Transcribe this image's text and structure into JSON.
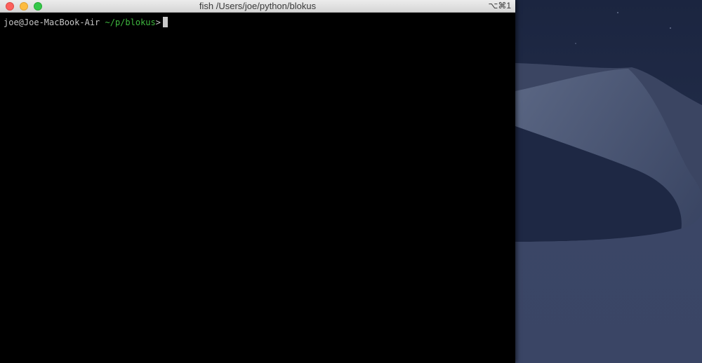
{
  "window": {
    "title": "fish /Users/joe/python/blokus",
    "shortcut": "⌥⌘1"
  },
  "terminal": {
    "prompt_user_host": "joe@Joe-MacBook-Air ",
    "prompt_cwd": "~/p/blokus",
    "prompt_symbol": ">"
  },
  "colors": {
    "terminal_bg": "#000000",
    "prompt_text": "#c8c8c8",
    "prompt_cwd": "#3fb83f",
    "close_button": "#fc605c",
    "minimize_button": "#fdbc40",
    "maximize_button": "#34c84a"
  },
  "wallpaper": {
    "name": "desert-dunes-night"
  }
}
